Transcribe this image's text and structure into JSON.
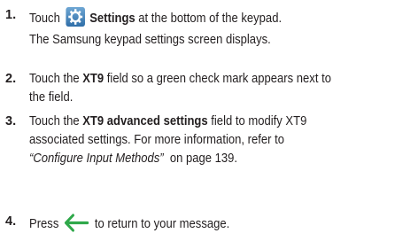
{
  "steps": [
    {
      "number": "1.",
      "before_icon": "Touch",
      "icon": "settings-gear-icon",
      "bold_label": "Settings",
      "after": " at the bottom of the keypad.",
      "note": "The Samsung keypad settings screen displays."
    },
    {
      "number": "2.",
      "t1": "Touch the ",
      "bold": "XT9",
      "t2": " field so a green check mark appears next to",
      "line2": "the field."
    },
    {
      "number": "3.",
      "t1": "Touch the ",
      "bold": "XT9 advanced settings",
      "t2": " field to modify XT9",
      "line2": "associated settings. For more information, refer to",
      "italic_ref": "“Configure Input Methods”",
      "page_ref": "  on page 139."
    },
    {
      "number": "4.",
      "before_icon": "Press",
      "icon": "back-arrow-icon",
      "after": " to return to your message."
    }
  ],
  "colors": {
    "text": "#231f20",
    "gear_bg": "#4a8cc4",
    "arrow": "#2fa84a"
  }
}
